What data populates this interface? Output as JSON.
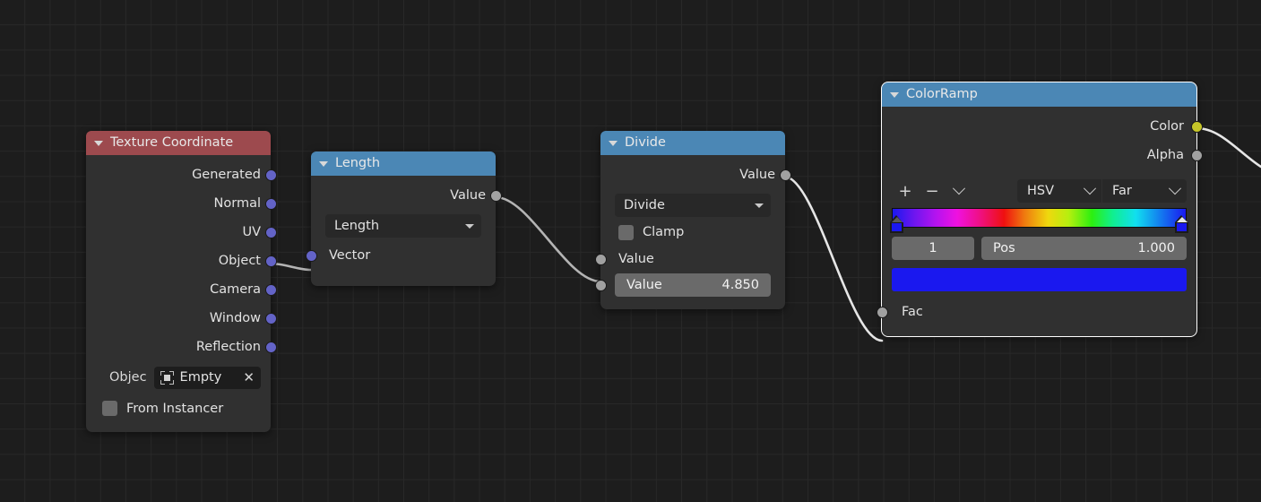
{
  "editor": {
    "name": "Blender Shader Node Editor",
    "background_color": "#1d1d1d",
    "grid_color": "#282828"
  },
  "nodes": {
    "texture_coordinate": {
      "title": "Texture Coordinate",
      "header_color": "#9d4a4e",
      "outputs": [
        {
          "label": "Generated",
          "socket": "vector-socket"
        },
        {
          "label": "Normal",
          "socket": "vector-socket"
        },
        {
          "label": "UV",
          "socket": "vector-socket"
        },
        {
          "label": "Object",
          "socket": "vector-socket"
        },
        {
          "label": "Camera",
          "socket": "vector-socket"
        },
        {
          "label": "Window",
          "socket": "vector-socket"
        },
        {
          "label": "Reflection",
          "socket": "vector-socket"
        }
      ],
      "object_label": "Objec",
      "object_value": "Empty",
      "object_clear": "✕",
      "from_instancer_label": "From Instancer",
      "from_instancer_checked": false
    },
    "length": {
      "title": "Length",
      "header_color": "#4b87b5",
      "output_label": "Value",
      "operation_value": "Length",
      "input_label": "Vector"
    },
    "divide": {
      "title": "Divide",
      "header_color": "#4b87b5",
      "output_label": "Value",
      "operation_value": "Divide",
      "clamp_label": "Clamp",
      "clamp_checked": false,
      "input_a_label": "Value",
      "input_b_label": "Value",
      "input_b_value": "4.850"
    },
    "colorramp": {
      "title": "ColorRamp",
      "header_color": "#4b87b5",
      "selected": true,
      "outputs": [
        {
          "label": "Color",
          "socket": "color-socket"
        },
        {
          "label": "Alpha",
          "socket": "value-socket"
        }
      ],
      "add_label": "+",
      "remove_label": "−",
      "menu_label": "",
      "interpolation_value": "HSV",
      "hue_interpolation_value": "Far",
      "gradient": {
        "stops": [
          {
            "pos": 0.0,
            "color": "#1a18ef",
            "selected": false
          },
          {
            "pos": 1.0,
            "color": "#1a18ef",
            "selected": true
          }
        ],
        "interpolation": "HSV Far",
        "ramp_css": "linear-gradient(to right, #1a18ef 0%, #6a16ef 7%, #b613ef 15%, #ef11e0 22%, #ef1080 30%, #ef1010 38%, #ef7a0f 45%, #efd80e 53%, #b6ef0f 60%, #2cef10 68%, #10ef8e 75%, #11dfef 83%, #1380ef 91%, #1a18ef 100%)"
      },
      "index_value": "1",
      "pos_label": "Pos",
      "pos_value": "1.000",
      "swatch_color": "#1a18ef",
      "input_label": "Fac"
    }
  },
  "links": [
    {
      "from": "texture_coordinate.Object",
      "to": "length.Vector"
    },
    {
      "from": "length.Value",
      "to": "divide.Value"
    },
    {
      "from": "divide.Value",
      "to": "colorramp.Fac"
    },
    {
      "from": "colorramp.Color",
      "to": "offscreen"
    }
  ]
}
